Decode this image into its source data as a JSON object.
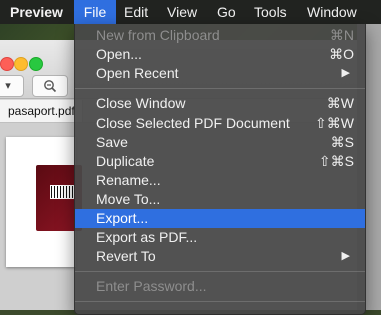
{
  "menubar": {
    "app": "Preview",
    "items": [
      "File",
      "Edit",
      "View",
      "Go",
      "Tools",
      "Window"
    ]
  },
  "window": {
    "tab_title": "pasaport.pdf"
  },
  "file_menu": {
    "new_from_clipboard": {
      "label": "New from Clipboard",
      "shortcut": "⌘N"
    },
    "open": {
      "label": "Open...",
      "shortcut": "⌘O"
    },
    "open_recent": {
      "label": "Open Recent"
    },
    "close_window": {
      "label": "Close Window",
      "shortcut": "⌘W"
    },
    "close_selected": {
      "label": "Close Selected PDF Document",
      "shortcut": "⇧⌘W"
    },
    "save": {
      "label": "Save",
      "shortcut": "⌘S"
    },
    "duplicate": {
      "label": "Duplicate",
      "shortcut": "⇧⌘S"
    },
    "rename": {
      "label": "Rename..."
    },
    "move_to": {
      "label": "Move To..."
    },
    "export": {
      "label": "Export..."
    },
    "export_pdf": {
      "label": "Export as PDF..."
    },
    "revert_to": {
      "label": "Revert To"
    },
    "enter_password": {
      "label": "Enter Password..."
    }
  },
  "colors": {
    "menu_highlight": "#2f6fe0",
    "menu_bg": "#484848"
  }
}
